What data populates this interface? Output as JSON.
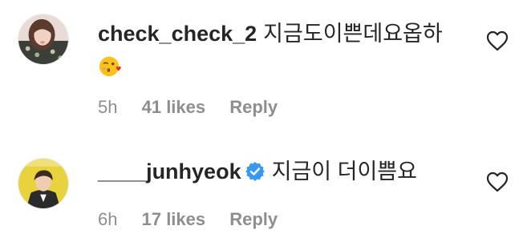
{
  "comments": [
    {
      "username": "check_check_2",
      "text": "지금도이쁜데요옵하",
      "emoji": "kissing-face-with-heart",
      "time": "5h",
      "likes": "41 likes",
      "reply": "Reply",
      "verified": false
    },
    {
      "username": "____junhyeok",
      "text": "지금이 더이쁨요",
      "time": "6h",
      "likes": "17 likes",
      "reply": "Reply",
      "verified": true
    }
  ],
  "colors": {
    "text": "#262626",
    "secondary": "#8e8e8e",
    "verified": "#3897f0",
    "background": "#ffffff"
  }
}
